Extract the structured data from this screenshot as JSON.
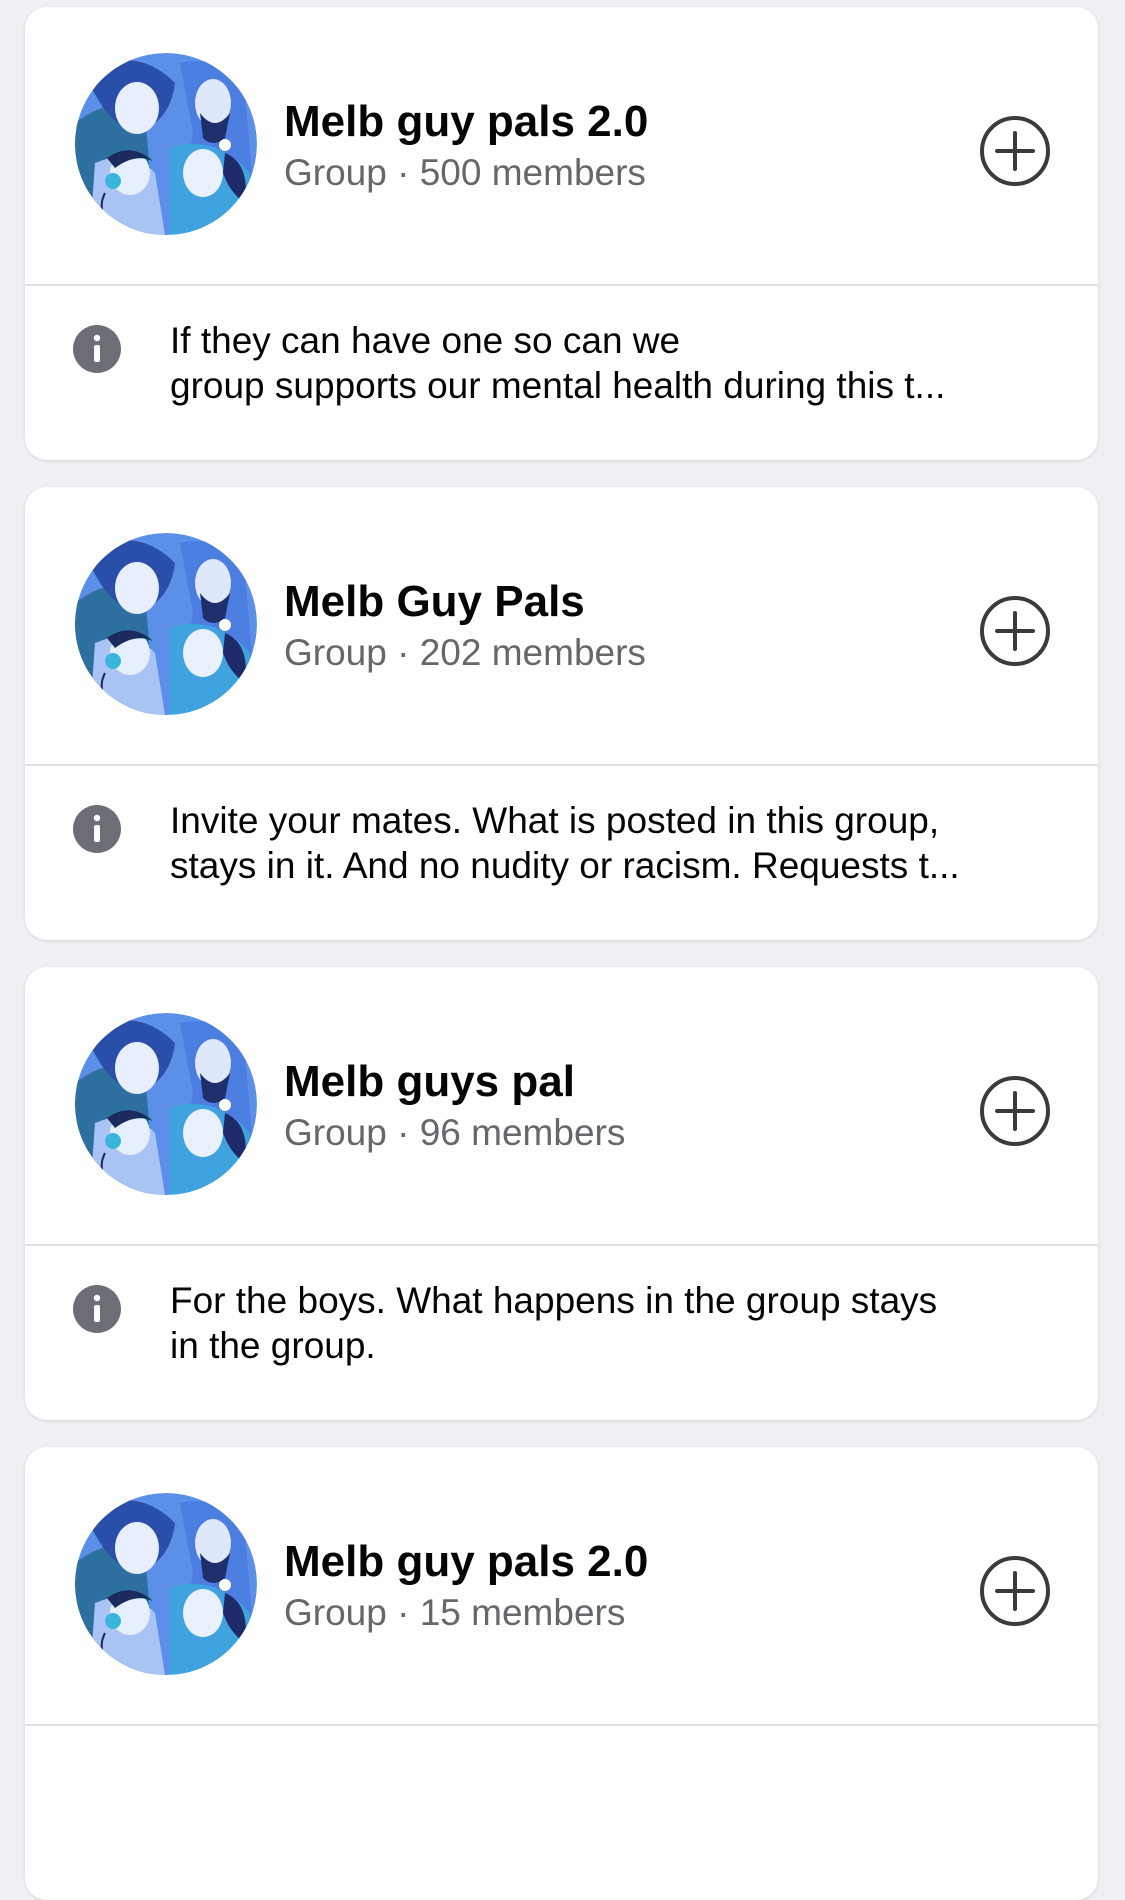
{
  "colors": {
    "background": "#eef0f3",
    "card": "#ffffff",
    "title_text": "#050505",
    "meta_text": "#65676b",
    "icon_gray": "#6b6f75",
    "avatar_bg": "#5b8fe8"
  },
  "icons": {
    "avatar": "group-illustration-avatar",
    "join": "plus-circle-icon",
    "info": "info-icon"
  },
  "groups": [
    {
      "name": "Melb guy pals 2.0",
      "meta": "Group · 500 members",
      "description_lines": [
        "If they can have one so can we",
        "group supports our mental health during this t..."
      ]
    },
    {
      "name": "Melb Guy Pals",
      "meta": "Group · 202 members",
      "description_lines": [
        "Invite your mates. What is posted in this group,",
        "stays in it. And no nudity or racism. Requests t..."
      ]
    },
    {
      "name": "Melb guys pal",
      "meta": "Group · 96 members",
      "description_lines": [
        "For the boys. What happens in the group stays",
        "in the group."
      ]
    },
    {
      "name": "Melb guy pals 2.0",
      "meta": "Group · 15 members",
      "description_lines": [
        "",
        ""
      ]
    }
  ]
}
